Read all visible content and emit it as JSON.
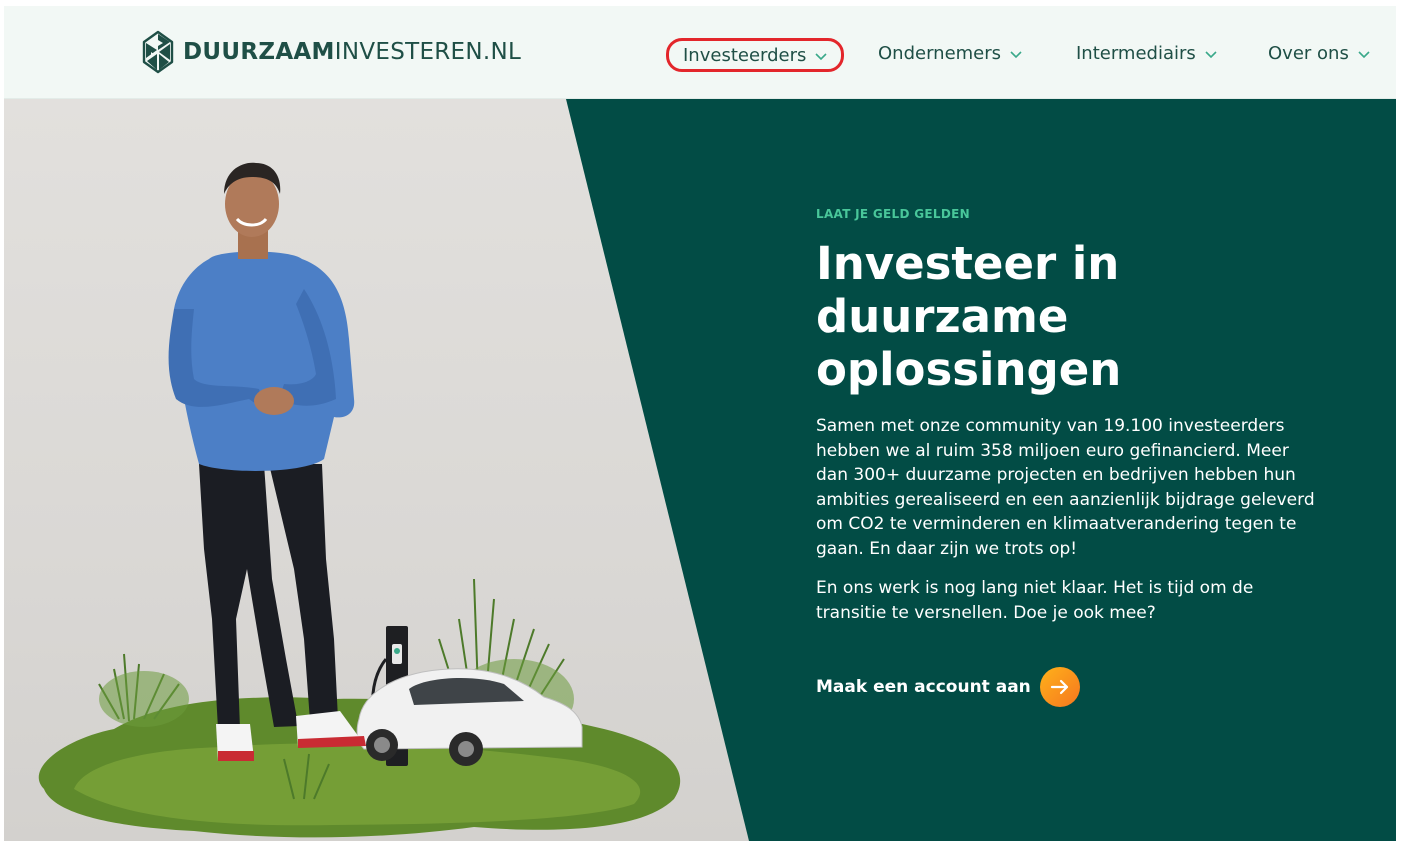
{
  "brand": {
    "bold": "DUURZAAM",
    "light": "INVESTEREN.NL"
  },
  "nav": {
    "items": [
      {
        "label": "Investeerders",
        "highlighted": true
      },
      {
        "label": "Ondernemers"
      },
      {
        "label": "Intermediairs"
      },
      {
        "label": "Over ons"
      }
    ]
  },
  "hero": {
    "eyebrow": "LAAT JE GELD GELDEN",
    "headline_lines": [
      "Investeer in",
      "duurzame",
      "oplossingen"
    ],
    "paragraph1": "Samen met onze community van 19.100 investeerders hebben we al ruim 358 miljoen euro gefinancierd. Meer dan 300+ duurzame projecten en bedrijven hebben hun ambities gerealiseerd en een aanzienlijk bijdrage geleverd om CO2 te verminderen en klimaatverandering tegen te gaan. En daar zijn we trots op!",
    "paragraph2": "En ons werk is nog lang niet klaar. Het is tijd om de transitie te versnellen. Doe je ook mee?",
    "cta_label": "Maak een account aan"
  },
  "colors": {
    "dark_green": "#024c45",
    "accent_green": "#49c79a",
    "cta_orange": "#f5861f",
    "highlight_red": "#e3262b",
    "header_bg": "#f2f8f5"
  },
  "icons": {
    "logo": "leaf-diamond-logo-icon",
    "nav_chevron": "chevron-down-icon",
    "cta": "arrow-right-icon"
  }
}
